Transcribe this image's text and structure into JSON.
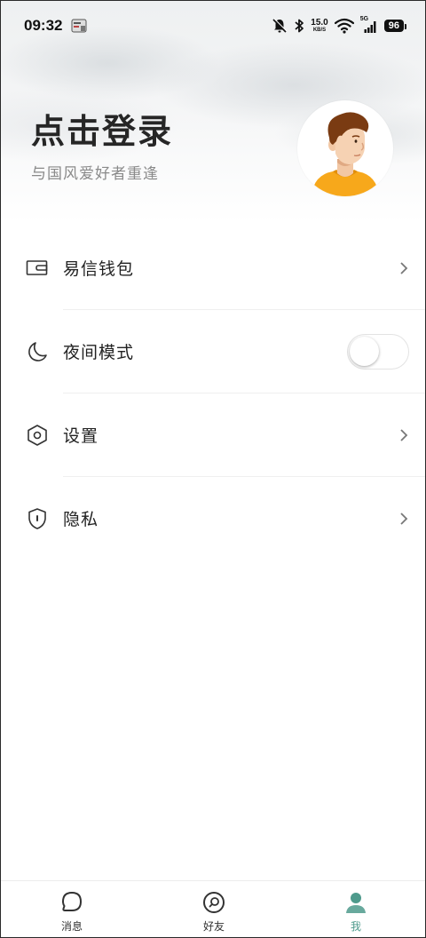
{
  "status_bar": {
    "time": "09:32",
    "net_speed_value": "15.0",
    "net_speed_unit": "KB/S",
    "network_type": "5G",
    "battery": "96"
  },
  "header": {
    "title": "点击登录",
    "subtitle": "与国风爱好者重逢"
  },
  "menu": {
    "items": [
      {
        "label": "易信钱包",
        "icon": "wallet-icon"
      },
      {
        "label": "夜间模式",
        "icon": "moon-icon",
        "toggle_on": false
      },
      {
        "label": "设置",
        "icon": "hexagon-settings-icon"
      },
      {
        "label": "隐私",
        "icon": "shield-lock-icon"
      }
    ]
  },
  "tabbar": {
    "tabs": [
      {
        "label": "消息",
        "icon": "chat-bubble-icon",
        "active": false
      },
      {
        "label": "好友",
        "icon": "friends-search-icon",
        "active": false
      },
      {
        "label": "我",
        "icon": "person-icon",
        "active": true
      }
    ]
  },
  "colors": {
    "accent": "#4e9a8c",
    "avatar_shirt": "#f7a81b",
    "avatar_hair": "#7a3b12"
  }
}
